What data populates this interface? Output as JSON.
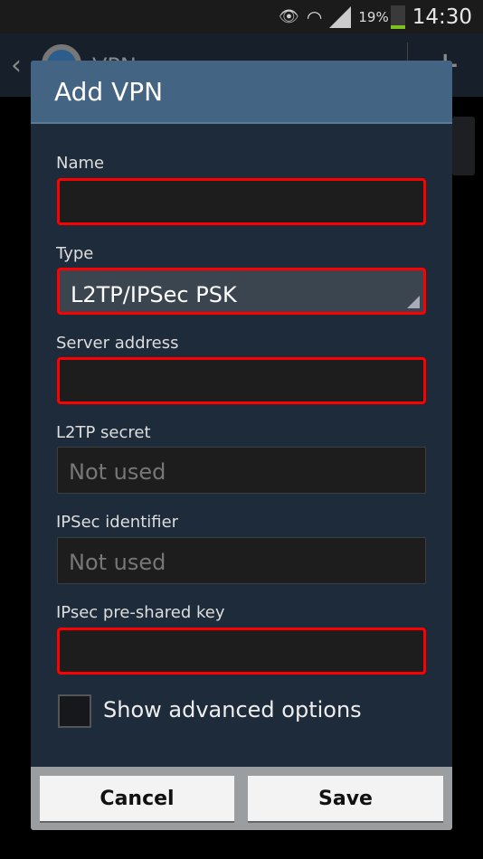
{
  "status_bar": {
    "battery": "19%",
    "time": "14:30",
    "icons": [
      "eye-icon",
      "wifi-icon",
      "signal-icon",
      "battery-icon"
    ]
  },
  "action_bar": {
    "title": "VPN"
  },
  "dialog": {
    "title": "Add VPN",
    "fields": [
      {
        "label": "Name",
        "value": "",
        "required": true
      },
      {
        "label": "Type",
        "value": "L2TP/IPSec PSK",
        "required": true
      },
      {
        "label": "Server address",
        "value": "",
        "required": true
      },
      {
        "label": "L2TP secret",
        "placeholder": "Not used"
      },
      {
        "label": "IPSec identifier",
        "placeholder": "Not used"
      },
      {
        "label": "IPsec pre-shared key",
        "value": "",
        "required": true
      }
    ],
    "advanced_label": "Show advanced options",
    "advanced_checked": false,
    "cancel": "Cancel",
    "save": "Save"
  },
  "colors": {
    "highlight": "#ff0000",
    "title_bar": "#436482",
    "dialog_bg": "#1e2b3a"
  }
}
